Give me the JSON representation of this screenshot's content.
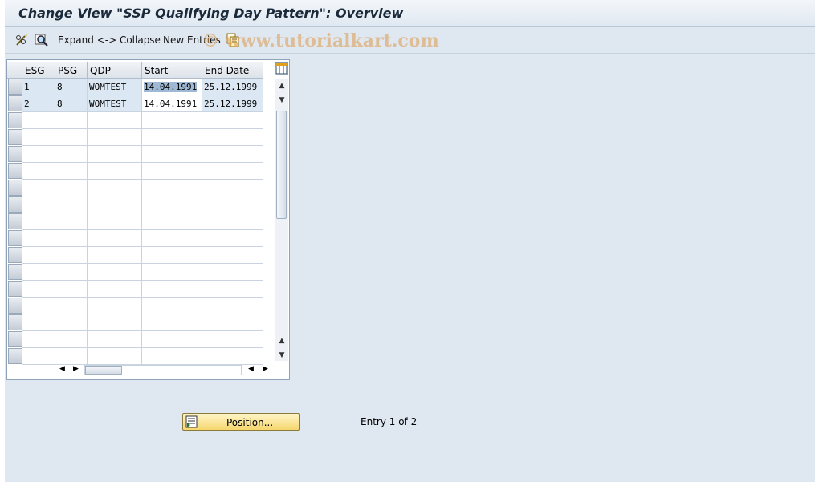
{
  "window": {
    "title": "Change View \"SSP Qualifying Day Pattern\": Overview"
  },
  "toolbar": {
    "change_display_icon": "pencil-glasses-icon",
    "find_icon": "find-icon",
    "expand_collapse_label": "Expand <-> Collapse",
    "new_entries_label": "New Entries",
    "copy_icon": "copy-icon",
    "watermark": "© www.tutorialkart.com"
  },
  "table": {
    "columns": [
      "ESG",
      "PSG",
      "QDP",
      "Start",
      "End Date"
    ],
    "rows": [
      {
        "esg": "1",
        "psg": "8",
        "qdp": "WOMTEST",
        "start": "14.04.1991",
        "end": "25.12.1999"
      },
      {
        "esg": "2",
        "psg": "8",
        "qdp": "WOMTEST",
        "start": "14.04.1991",
        "end": "25.12.1999"
      }
    ]
  },
  "footer": {
    "position_label": "Position...",
    "entry_text": "Entry 1 of 2"
  },
  "colors": {
    "background": "#dfe8f1",
    "data_row": "#dbe7f3",
    "button_yellow": "#f5d76e",
    "watermark": "#dea05a"
  }
}
